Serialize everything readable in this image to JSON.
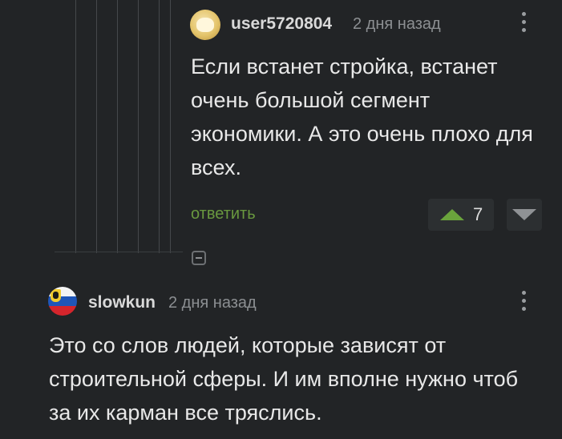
{
  "comments": [
    {
      "username": "user5720804",
      "time": "2 дня назад",
      "text": "Если встанет стройка, встанет очень большой сегмент экономики. А это очень плохо для всех.",
      "reply_label": "ответить",
      "votes": "7",
      "avatar_icon": "avatar-icon"
    },
    {
      "username": "slowkun",
      "time": "2 дня назад",
      "text": "Это со слов людей, которые зависят от строительной сферы. И им вполне нужно чтоб за их карман все тряслись.",
      "avatar_icon": "flag-avatar-icon"
    }
  ],
  "colors": {
    "background": "#222426",
    "accent_green": "#69983f",
    "vote_up": "#6aa33c",
    "muted_text": "#8c8f92"
  }
}
